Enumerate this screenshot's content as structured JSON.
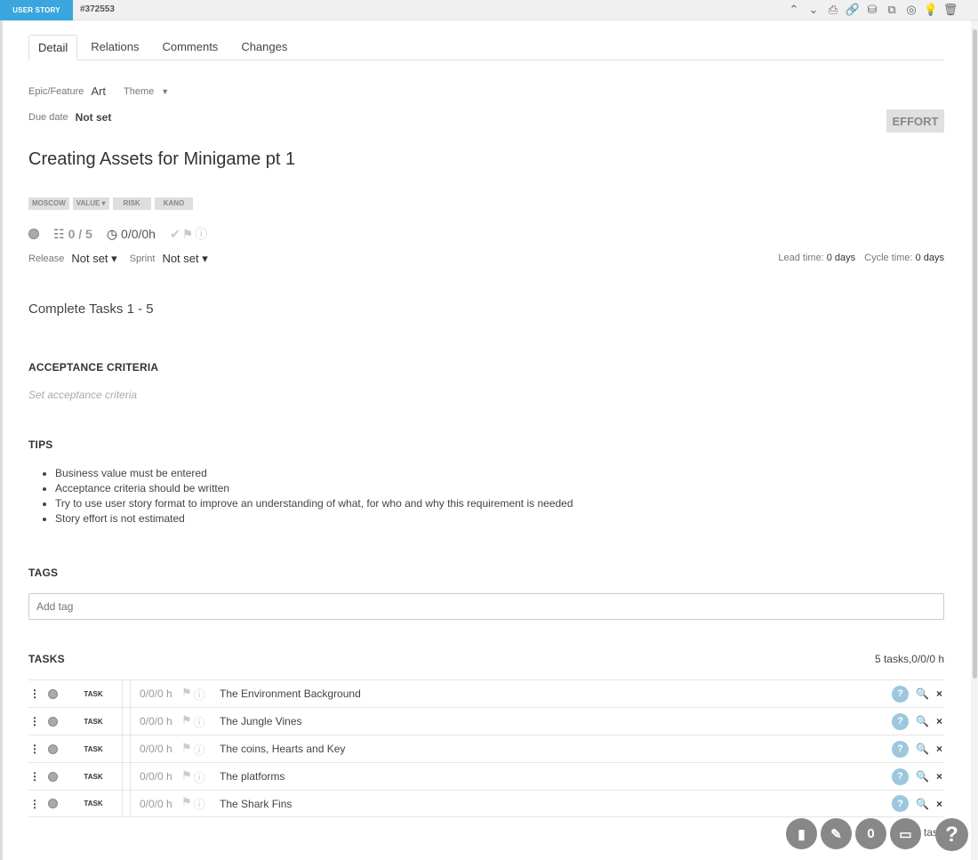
{
  "header": {
    "type_label": "USER STORY",
    "id": "#372553",
    "toolbar_icons": [
      "up-chevron-icon",
      "down-chevron-icon",
      "printer-icon",
      "link-icon",
      "paint-bucket-icon",
      "copy-icon",
      "globe-icon",
      "lightbulb-icon",
      "trash-icon"
    ]
  },
  "tabs": [
    {
      "label": "Detail"
    },
    {
      "label": "Relations"
    },
    {
      "label": "Comments"
    },
    {
      "label": "Changes"
    }
  ],
  "meta": {
    "epic_label": "Epic/Feature",
    "epic_value": "Art",
    "theme_label": "Theme",
    "due_label": "Due date",
    "due_value": "Not set",
    "effort_label": "EFFORT"
  },
  "title": "Creating Assets for Minigame pt 1",
  "pills": {
    "moscow": "MOSCOW",
    "value": "VALUE",
    "risk": "RISK",
    "kano": "KANO"
  },
  "status": {
    "tasks_done": "0 / 5",
    "time": "0/0/0h"
  },
  "release": {
    "release_label": "Release",
    "release_value": "Not set",
    "sprint_label": "Sprint",
    "sprint_value": "Not set",
    "lead_label": "Lead time:",
    "lead_value": "0 days",
    "cycle_label": "Cycle time:",
    "cycle_value": "0 days"
  },
  "description": "Complete Tasks 1 - 5",
  "acceptance": {
    "heading": "ACCEPTANCE CRITERIA",
    "placeholder": "Set acceptance criteria"
  },
  "tips": {
    "heading": "TIPS",
    "items": [
      "Business value must be entered",
      "Acceptance criteria should be written",
      "Try to use user story format to improve an understanding of what, for who and why this requirement is needed",
      "Story effort is not estimated"
    ]
  },
  "tags": {
    "heading": "TAGS",
    "placeholder": "Add tag"
  },
  "tasks": {
    "heading": "TASKS",
    "summary": "5  tasks,0/0/0 h",
    "rows": [
      {
        "type": "TASK",
        "time": "0/0/0 h",
        "name": "The Environment Background"
      },
      {
        "type": "TASK",
        "time": "0/0/0 h",
        "name": "The Jungle Vines"
      },
      {
        "type": "TASK",
        "time": "0/0/0 h",
        "name": "The coins, Hearts and Key"
      },
      {
        "type": "TASK",
        "time": "0/0/0 h",
        "name": "The platforms"
      },
      {
        "type": "TASK",
        "time": "0/0/0 h",
        "name": "The Shark Fins"
      }
    ]
  },
  "fab": {
    "count": "0",
    "label": "task",
    "help": "?"
  }
}
